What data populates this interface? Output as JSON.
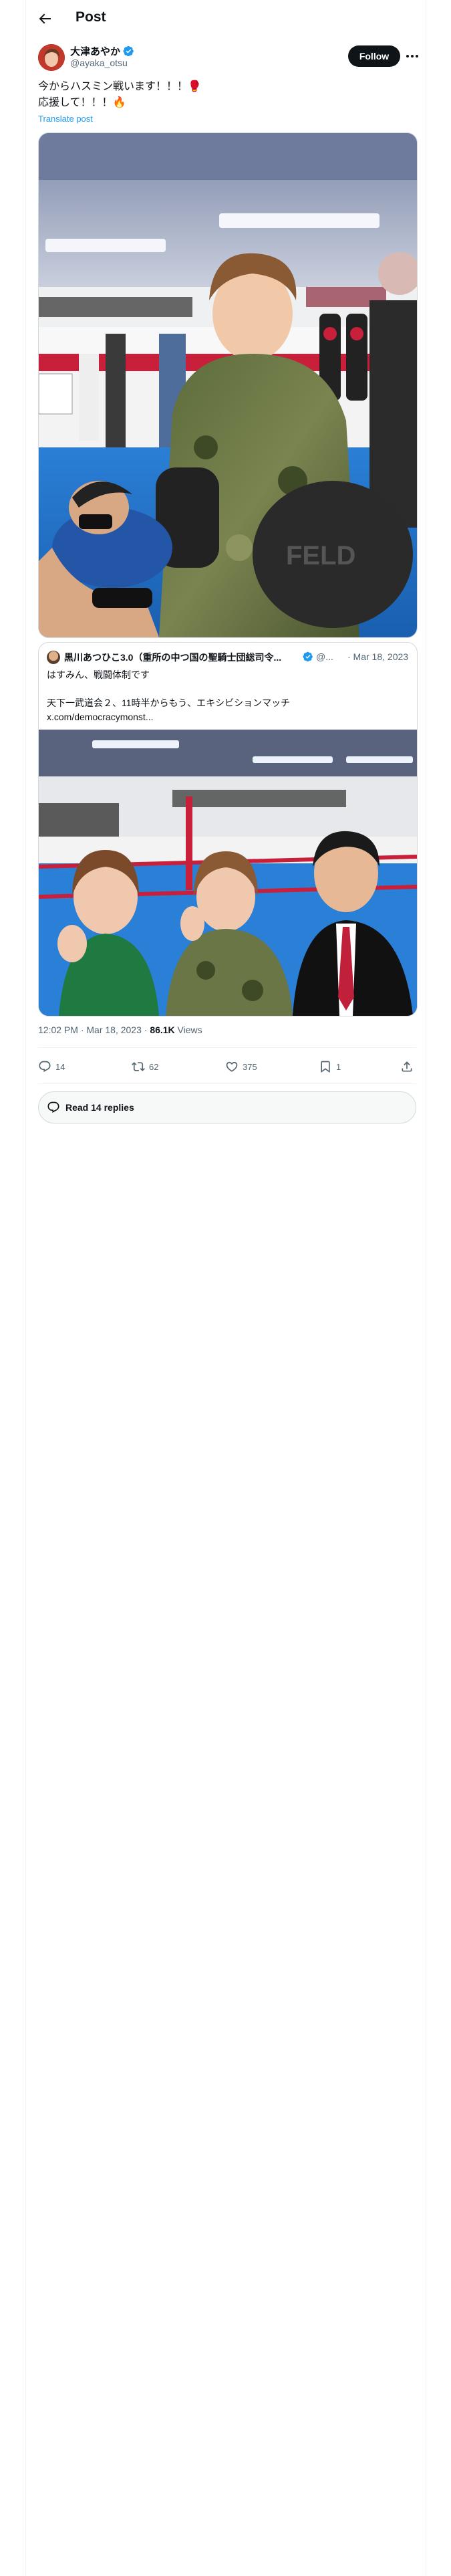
{
  "header": {
    "title": "Post"
  },
  "author": {
    "name": "大津あやか",
    "handle": "@ayaka_otsu",
    "follow_label": "Follow"
  },
  "post": {
    "lines": [
      "今からハスミン戦います！！！🥊",
      "応援して！！！🔥"
    ],
    "translate_label": "Translate post"
  },
  "quote": {
    "author_name": "黒川あつひこ3.0（重所の中つ国の聖騎士団総司令...",
    "handle": "@...",
    "date": "· Mar 18, 2023",
    "lines": [
      "はすみん、戦闘体制です",
      "",
      "天下一武道会２、11時半からもう、エキシビションマッチ",
      "x.com/democracymonst..."
    ]
  },
  "meta": {
    "timestamp": "12:02 PM · Mar 18, 2023 · ",
    "views_count": "86.1K",
    "views_label": " Views"
  },
  "actions": {
    "replies": "14",
    "reposts": "62",
    "likes": "375",
    "bookmarks": "1"
  },
  "read_replies_label": "Read 14 replies",
  "colors": {
    "accent": "#1d9bf0",
    "text": "#0f1419",
    "muted": "#536471",
    "border": "#cfd9de"
  }
}
